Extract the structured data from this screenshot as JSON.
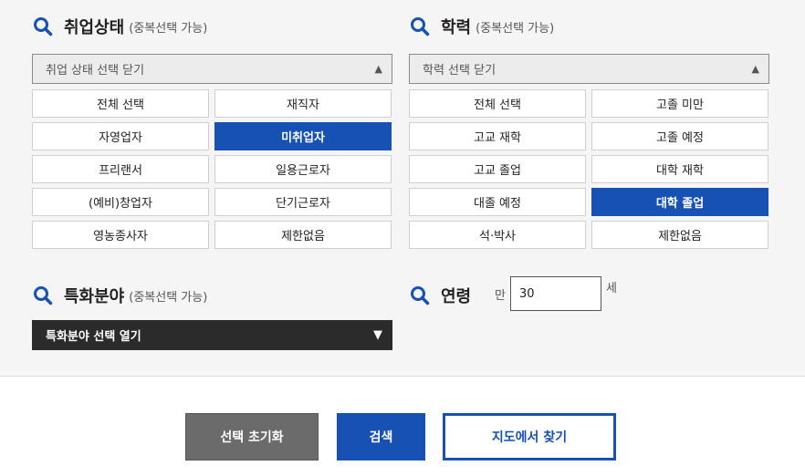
{
  "employment": {
    "title": "취업상태",
    "subtitle": "(중복선택 가능)",
    "dropdown_label": "취업 상태 선택 닫기",
    "dropdown_arrow": "▲",
    "options": [
      "전체 선택",
      "재직자",
      "자영업자",
      "미취업자",
      "프리랜서",
      "일용근로자",
      "(예비)창업자",
      "단기근로자",
      "영농종사자",
      "제한없음"
    ],
    "selected": "미취업자"
  },
  "education": {
    "title": "학력",
    "subtitle": "(중복선택 가능)",
    "dropdown_label": "학력 선택 닫기",
    "dropdown_arrow": "▲",
    "options": [
      "전체 선택",
      "고졸 미만",
      "고교 재학",
      "고졸 예정",
      "고교 졸업",
      "대학 재학",
      "대졸 예정",
      "대학 졸업",
      "석·박사",
      "제한없음"
    ],
    "selected": "대학 졸업"
  },
  "specialty": {
    "title": "특화분야",
    "subtitle": "(중복선택 가능)",
    "dropdown_label": "특화분야 선택 열기",
    "dropdown_arrow": "▼"
  },
  "age": {
    "title": "연령",
    "prefix": "만",
    "value": "30",
    "suffix": "세"
  },
  "buttons": {
    "reset": "선택 초기화",
    "search": "검색",
    "map": "지도에서 찾기"
  },
  "colors": {
    "accent": "#1651b3",
    "reset_button": "#6b6b6b",
    "dark_dropdown": "#2b2b2b",
    "panel_background": "#f5f5f5"
  },
  "icons": {
    "section": "search-icon"
  }
}
